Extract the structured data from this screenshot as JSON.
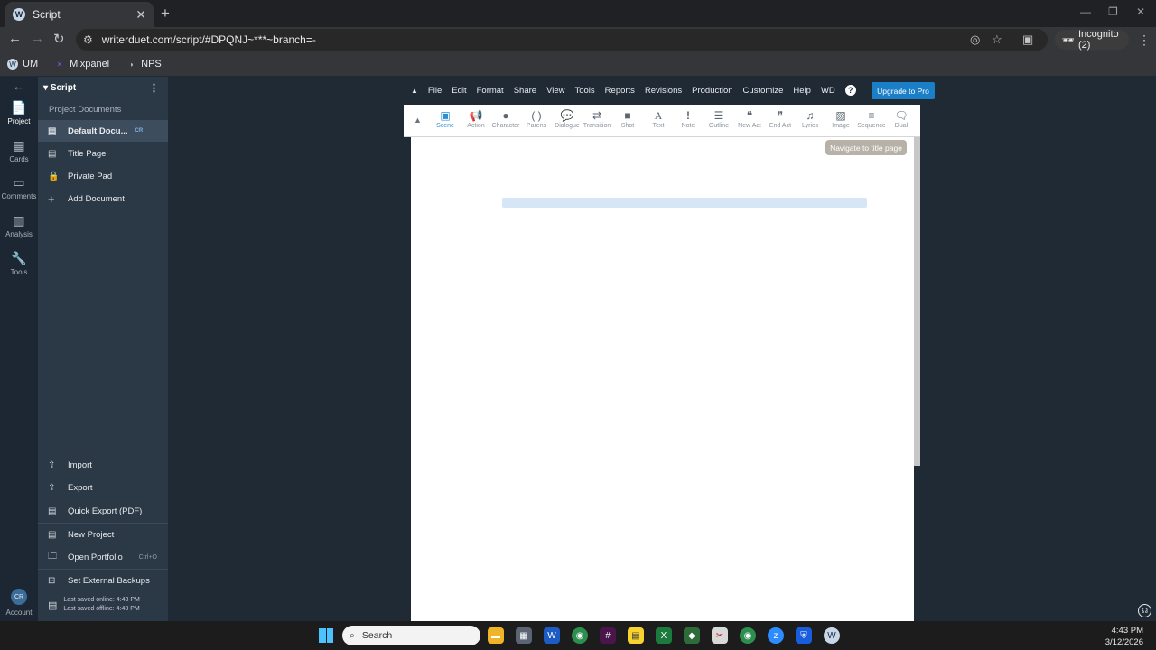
{
  "browser": {
    "tab_title": "Script",
    "tab_favicon": "W",
    "url": "writerduet.com/script/#DPQNJ~***~branch=-",
    "incognito_label": "Incognito (2)",
    "bookmarks": [
      {
        "label": "UM",
        "icon": "um-icon"
      },
      {
        "label": "Mixpanel",
        "icon": "mixpanel-icon"
      },
      {
        "label": "NPS",
        "icon": "nps-icon"
      }
    ]
  },
  "rail": {
    "items": [
      {
        "label": "Project",
        "icon": "project-icon"
      },
      {
        "label": "Cards",
        "icon": "cards-icon"
      },
      {
        "label": "Comments",
        "icon": "comments-icon"
      },
      {
        "label": "Analysis",
        "icon": "analysis-icon"
      },
      {
        "label": "Tools",
        "icon": "tools-icon"
      }
    ],
    "account_initials": "CR",
    "account_label": "Account"
  },
  "panel": {
    "title": "Script",
    "section_label": "Project Documents",
    "documents": [
      {
        "label": "Default Docu...",
        "badge": "CR",
        "active": true
      },
      {
        "label": "Title Page"
      },
      {
        "label": "Private Pad"
      },
      {
        "label": "Add Document"
      }
    ],
    "actions": [
      {
        "label": "Import"
      },
      {
        "label": "Export"
      },
      {
        "label": "Quick Export (PDF)"
      },
      {
        "label": "New Project"
      },
      {
        "label": "Open Portfolio",
        "shortcut": "Ctrl+O"
      },
      {
        "label": "Set External Backups"
      }
    ],
    "saved_online": "Last saved online: 4:43 PM",
    "saved_offline": "Last saved offline: 4:43 PM"
  },
  "menu": {
    "items": [
      "File",
      "Edit",
      "Format",
      "Share",
      "View",
      "Tools",
      "Reports",
      "Revisions",
      "Production",
      "Customize",
      "Help",
      "WD"
    ],
    "help_glyph": "?",
    "upgrade_label": "Upgrade to Pro"
  },
  "toolbar": {
    "tools": [
      {
        "label": "Scene",
        "icon": "image-icon",
        "active": true
      },
      {
        "label": "Action",
        "icon": "megaphone-icon"
      },
      {
        "label": "Character",
        "icon": "person-icon"
      },
      {
        "label": "Parens",
        "icon": "parens-icon"
      },
      {
        "label": "Dialogue",
        "icon": "speech-bubble-icon"
      },
      {
        "label": "Transition",
        "icon": "arrows-icon"
      },
      {
        "label": "Shot",
        "icon": "camera-icon"
      },
      {
        "label": "Text",
        "icon": "text-icon"
      },
      {
        "label": "Note",
        "icon": "exclamation-icon"
      },
      {
        "label": "Outline",
        "icon": "outline-icon"
      },
      {
        "label": "New Act",
        "icon": "open-quote-icon"
      },
      {
        "label": "End Act",
        "icon": "close-quote-icon"
      },
      {
        "label": "Lyrics",
        "icon": "music-icon"
      },
      {
        "label": "Image",
        "icon": "picture-icon"
      },
      {
        "label": "Sequence",
        "icon": "sequence-icon"
      },
      {
        "label": "Dual",
        "icon": "dual-bubble-icon"
      }
    ]
  },
  "editor": {
    "tooltip": "Navigate to title page"
  },
  "taskbar": {
    "search_placeholder": "Search",
    "time": "4:43 PM",
    "date": "3/12/2026"
  }
}
